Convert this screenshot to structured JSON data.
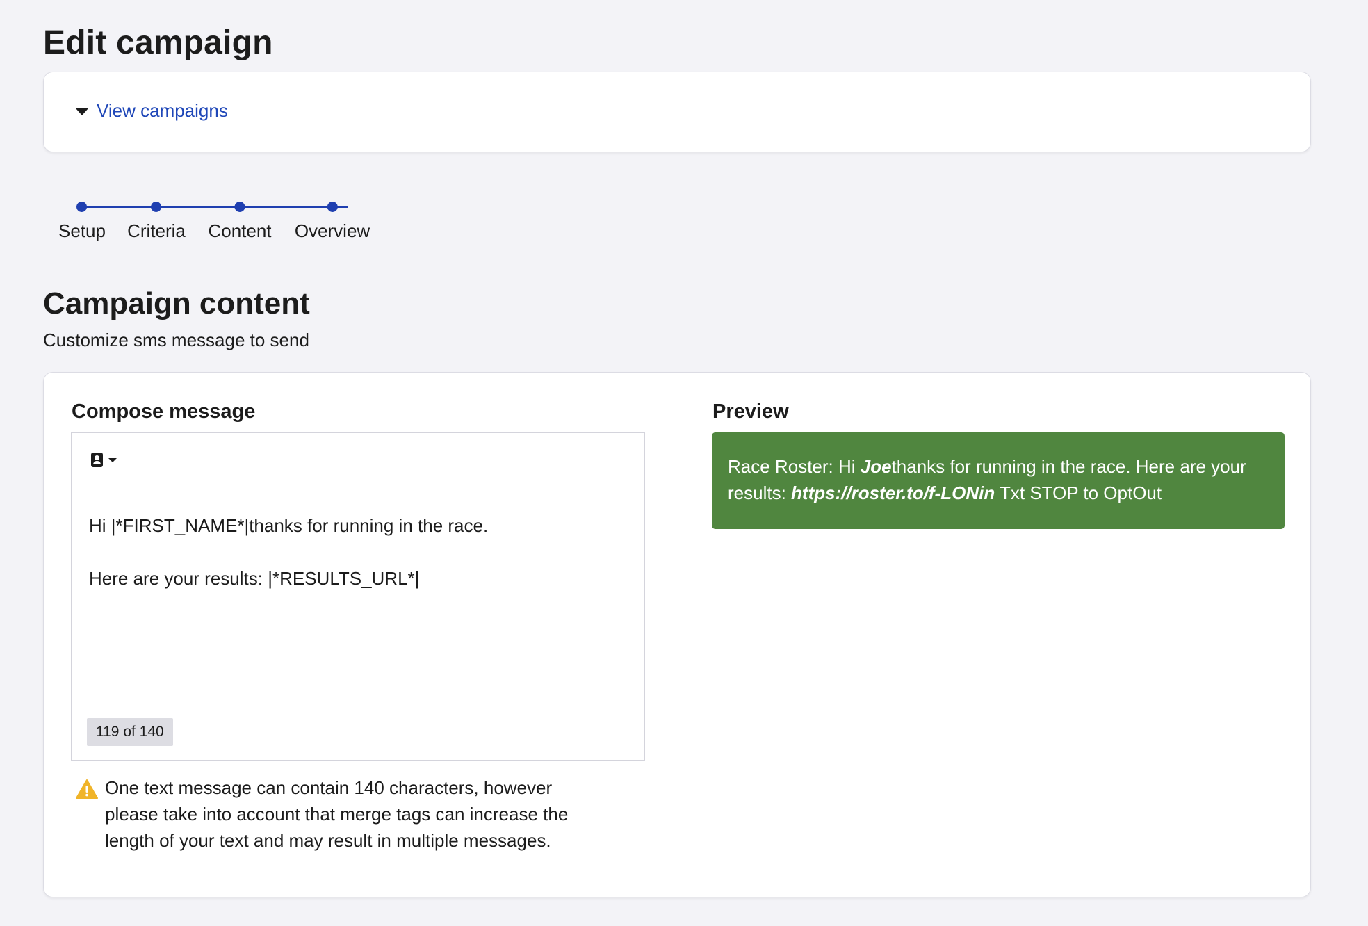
{
  "page": {
    "title": "Edit campaign"
  },
  "top_card": {
    "view_link": "View campaigns"
  },
  "stepper": {
    "steps": [
      {
        "label": "Setup"
      },
      {
        "label": "Criteria"
      },
      {
        "label": "Content"
      },
      {
        "label": "Overview"
      }
    ],
    "accent_color": "#1f3fb0"
  },
  "section": {
    "title": "Campaign content",
    "subtitle": "Customize sms message to send"
  },
  "compose": {
    "label": "Compose message",
    "merge_button_icon": "contact-card-icon",
    "line1": "Hi |*FIRST_NAME*|thanks for running in the race.",
    "line2": "Here are your results: |*RESULTS_URL*|",
    "counter": "119 of 140",
    "warning": "One text message can contain 140 characters, however please take into account that merge tags can increase the length of your text and may result in multiple messages.",
    "warning_icon": "warning-triangle-icon"
  },
  "preview": {
    "label": "Preview",
    "part1": "Race Roster: Hi ",
    "name": "Joe",
    "part2": "thanks for running in the race. Here are your results: ",
    "url": "https://roster.to/f-LONin",
    "part3": " Txt STOP to OptOut",
    "bubble_color": "#50863f"
  }
}
